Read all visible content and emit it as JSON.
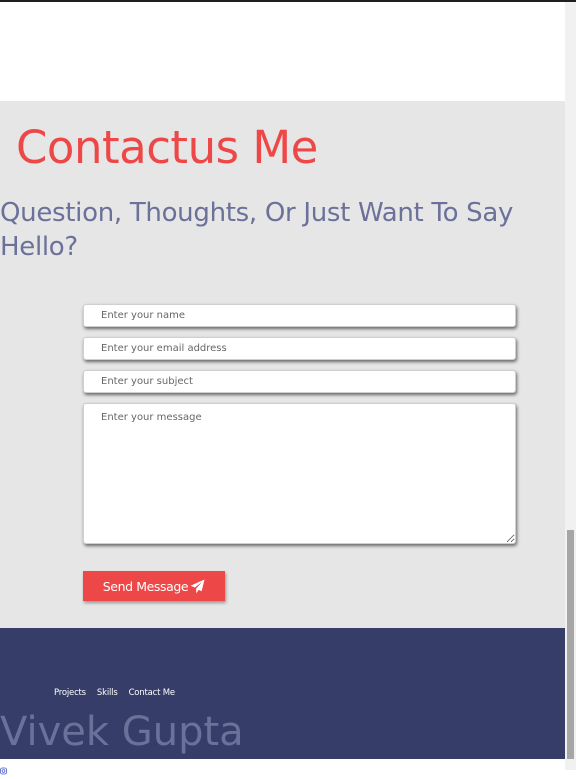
{
  "contact": {
    "title": "Contactus Me",
    "subtitle": "Question, Thoughts, Or Just Want To Say Hello?"
  },
  "form": {
    "name_placeholder": "Enter your name",
    "email_placeholder": "Enter your email address",
    "subject_placeholder": "Enter your subject",
    "message_placeholder": "Enter your message",
    "submit_label": "Send Message",
    "submit_icon": "paper-plane-icon"
  },
  "footer": {
    "nav": [
      "Projects",
      "Skills",
      "Contact Me"
    ],
    "brand": "Vivek Gupta",
    "social_icon": "instagram-icon"
  },
  "colors": {
    "accent": "#ee4747",
    "subtitle": "#6b7199",
    "section_bg": "#e6e6e6",
    "footer_bg": "#353d68"
  }
}
